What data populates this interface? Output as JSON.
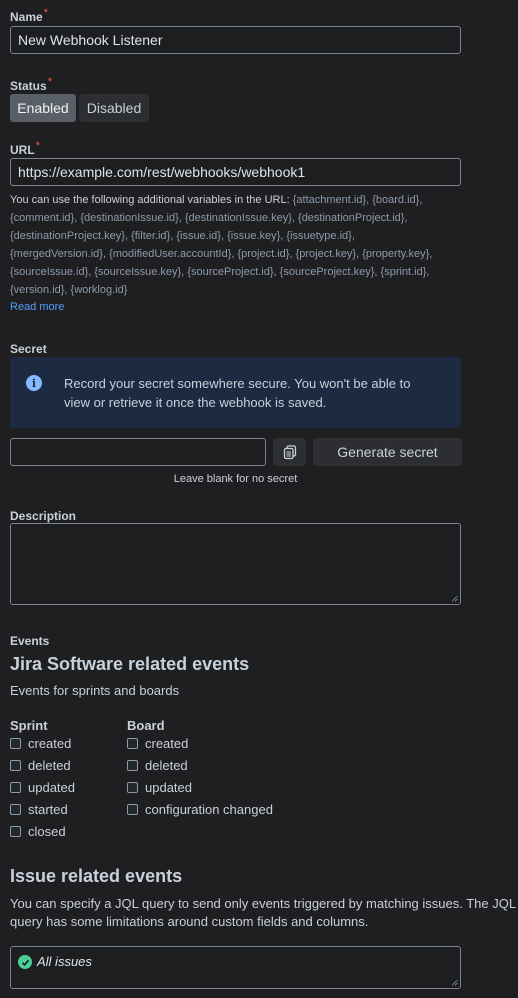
{
  "name_field": {
    "label": "Name",
    "required_mark": "*",
    "value": "New Webhook Listener"
  },
  "status_field": {
    "label": "Status",
    "required_mark": "*",
    "options": [
      "Enabled",
      "Disabled"
    ],
    "selected": "Enabled"
  },
  "url_field": {
    "label": "URL",
    "required_mark": "*",
    "value": "https://example.com/rest/webhooks/webhook1",
    "help_intro": "You can use the following additional variables in the URL: ",
    "help_variables": "{attachment.id}, {board.id}, {comment.id}, {destinationIssue.id}, {destinationIssue.key}, {destinationProject.id}, {destinationProject.key}, {filter.id}, {issue.id}, {issue.key}, {issuetype.id}, {mergedVersion.id}, {modifiedUser.accountId}, {project.id}, {project.key}, {property.key}, {sourceIssue.id}, {sourceIssue.key}, {sourceProject.id}, {sourceProject.key}, {sprint.id}, {version.id}, {worklog.id}",
    "read_more": "Read more"
  },
  "secret_field": {
    "label": "Secret",
    "banner_text": "Record your secret somewhere secure. You won't be able to view or retrieve it once the webhook is saved.",
    "value": "",
    "generate_label": "Generate secret",
    "hint": "Leave blank for no secret"
  },
  "description_field": {
    "label": "Description",
    "value": ""
  },
  "events": {
    "label": "Events",
    "jira_software_heading": "Jira Software related events",
    "jira_software_sub": "Events for sprints and boards",
    "sprint": {
      "title": "Sprint",
      "items": [
        "created",
        "deleted",
        "updated",
        "started",
        "closed"
      ]
    },
    "board": {
      "title": "Board",
      "items": [
        "created",
        "deleted",
        "updated",
        "configuration changed"
      ]
    },
    "issue_heading": "Issue related events",
    "issue_desc": "You can specify a JQL query to send only events triggered by matching issues. The JQL query has some limitations around custom fields and columns.",
    "jql_value": "All issues"
  },
  "colors": {
    "accent_link": "#579dff",
    "required": "#ef5c48",
    "info_banner": "#1c2b41",
    "success": "#4bce97"
  },
  "icons": {
    "info": "info-icon",
    "copy": "copy-icon",
    "valid": "check-circle-icon"
  }
}
